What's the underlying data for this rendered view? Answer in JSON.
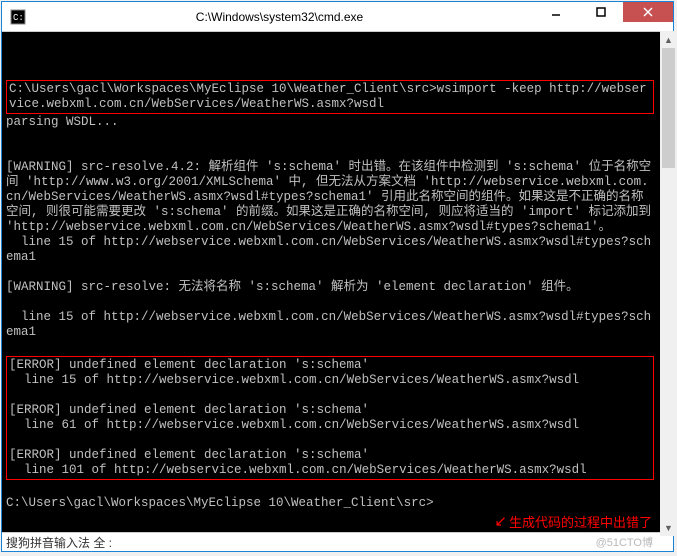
{
  "window": {
    "title": "C:\\Windows\\system32\\cmd.exe"
  },
  "console": {
    "cmd_line": "C:\\Users\\gacl\\Workspaces\\MyEclipse 10\\Weather_Client\\src>wsimport -keep http://webservice.webxml.com.cn/WebServices/WeatherWS.asmx?wsdl",
    "parsing": "parsing WSDL...",
    "warn1": "[WARNING] src-resolve.4.2: 解析组件 's:schema' 时出错。在该组件中检测到 's:schema' 位于名称空间 'http://www.w3.org/2001/XMLSchema' 中, 但无法从方案文档 'http://webservice.webxml.com.cn/WebServices/WeatherWS.asmx?wsdl#types?schema1' 引用此名称空间的组件。如果这是不正确的名称空间, 则很可能需要更改 's:schema' 的前缀。如果这是正确的名称空间, 则应将适当的 'import' 标记添加到 'http://webservice.webxml.com.cn/WebServices/WeatherWS.asmx?wsdl#types?schema1'。",
    "warn1_line": "  line 15 of http://webservice.webxml.com.cn/WebServices/WeatherWS.asmx?wsdl#types?schema1",
    "warn2": "[WARNING] src-resolve: 无法将名称 's:schema' 解析为 'element declaration' 组件。",
    "warn2_line": "  line 15 of http://webservice.webxml.com.cn/WebServices/WeatherWS.asmx?wsdl#types?schema1",
    "err1": "[ERROR] undefined element declaration 's:schema'",
    "err1_line": "  line 15 of http://webservice.webxml.com.cn/WebServices/WeatherWS.asmx?wsdl",
    "err2": "[ERROR] undefined element declaration 's:schema'",
    "err2_line": "  line 61 of http://webservice.webxml.com.cn/WebServices/WeatherWS.asmx?wsdl",
    "err3": "[ERROR] undefined element declaration 's:schema'",
    "err3_line": "  line 101 of http://webservice.webxml.com.cn/WebServices/WeatherWS.asmx?wsdl",
    "prompt2": "C:\\Users\\gacl\\Workspaces\\MyEclipse 10\\Weather_Client\\src>"
  },
  "ime": {
    "text": "搜狗拼音输入法 全 :"
  },
  "annotation": {
    "arrow": "↙",
    "text": "生成代码的过程中出错了"
  },
  "watermark": {
    "text": "@51CTO博"
  }
}
